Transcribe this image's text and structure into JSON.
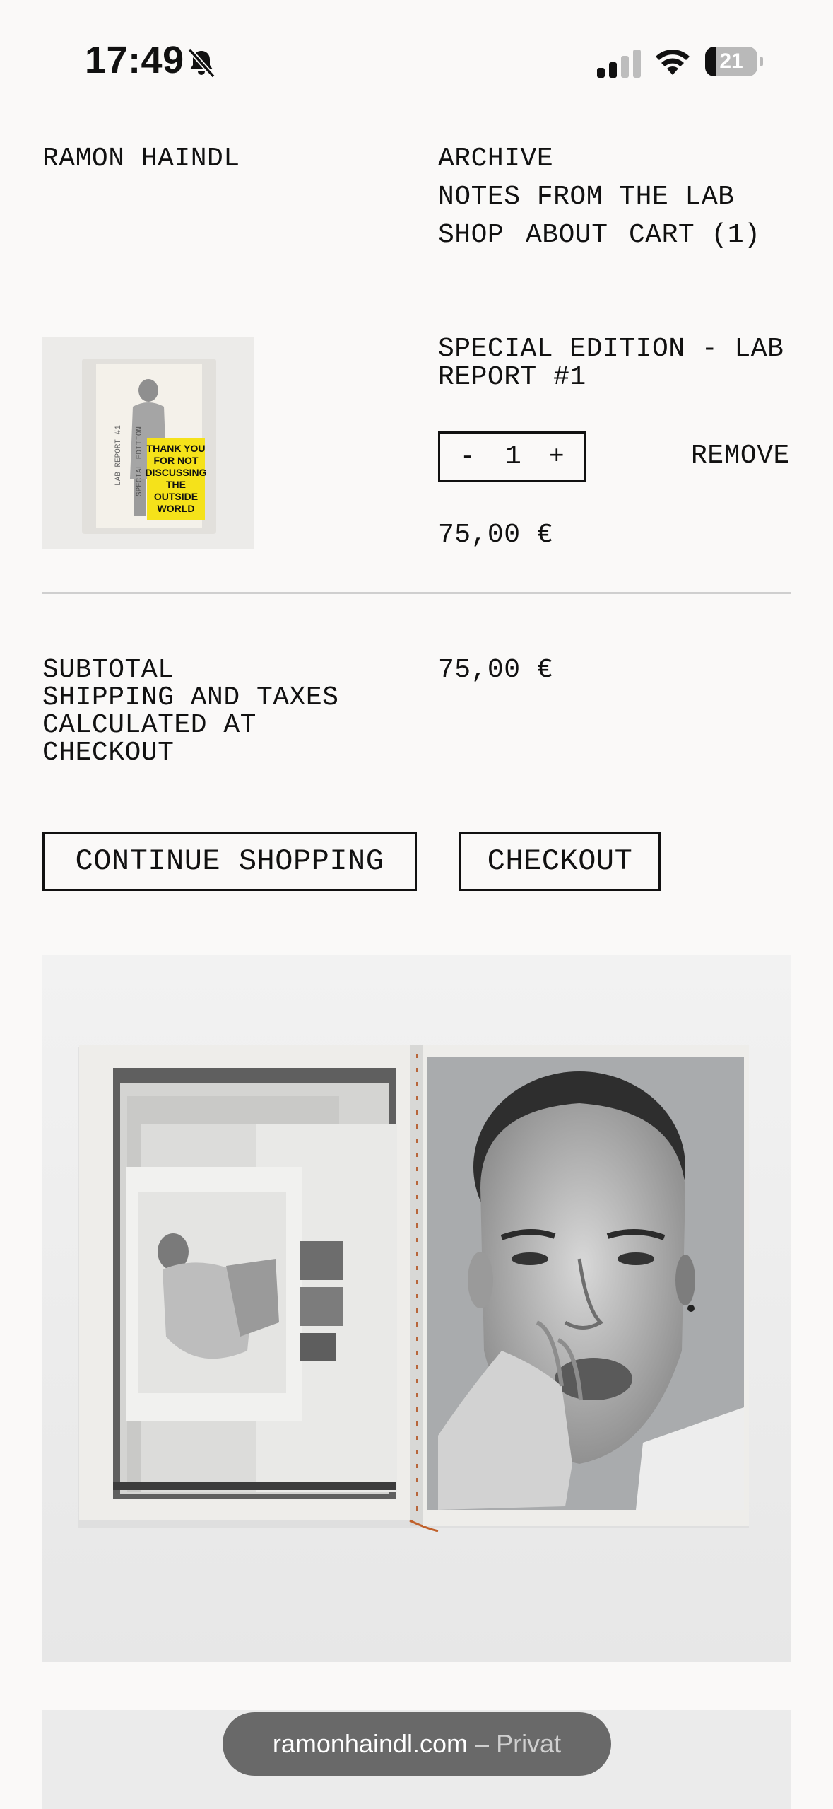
{
  "status_bar": {
    "time": "17:49",
    "battery_level": "21",
    "icons": [
      "bell-muted-icon",
      "cellular-signal-icon",
      "wifi-icon",
      "battery-icon"
    ]
  },
  "header": {
    "brand": "RAMON HAINDL",
    "nav": {
      "archive": "ARCHIVE",
      "notes": "NOTES FROM THE LAB",
      "shop": "SHOP",
      "about": "ABOUT",
      "cart": "CART (1)"
    }
  },
  "cart_item": {
    "name_line1": "SPECIAL EDITION - LAB",
    "name_line2": "REPORT #1",
    "qty_minus": "-",
    "quantity": "1",
    "qty_plus": "+",
    "remove_label": "REMOVE",
    "price": "75,00 €",
    "thumbnail": {
      "spine_text_1": "LAB REPORT #1",
      "spine_text_2": "SPECIAL EDITION",
      "sticker_lines": [
        "THANK YOU",
        "FOR NOT",
        "DISCUSSING",
        "THE",
        "OUTSIDE",
        "WORLD"
      ],
      "sticker_color": "#f5e21a"
    }
  },
  "summary": {
    "line1": "SUBTOTAL",
    "line2": "SHIPPING AND TAXES",
    "line3": "CALCULATED AT",
    "line4": "CHECKOUT",
    "subtotal_value": "75,00 €"
  },
  "actions": {
    "continue_label": "CONTINUE SHOPPING",
    "checkout_label": "CHECKOUT"
  },
  "browser": {
    "domain": "ramonhaindl.com",
    "separator": " – ",
    "mode": "Privat"
  }
}
